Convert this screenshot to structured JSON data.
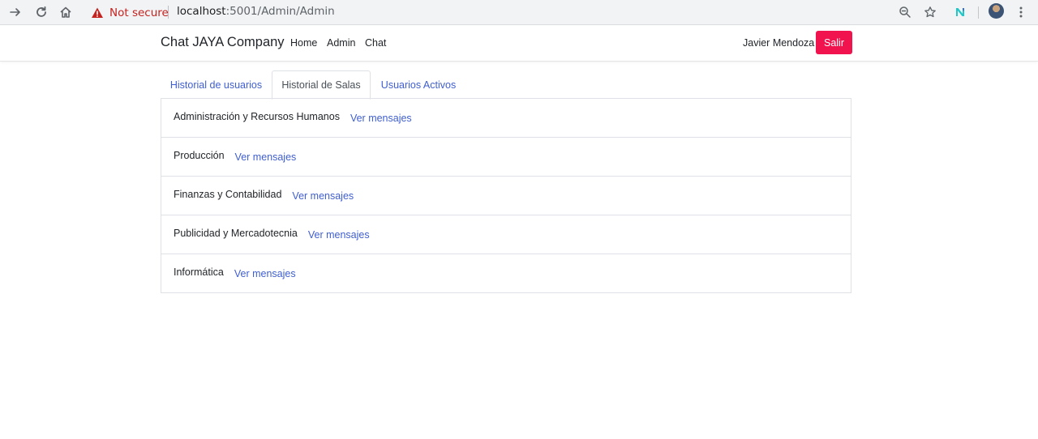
{
  "browser": {
    "security_label": "Not secure",
    "url_host": "localhost",
    "url_rest": ":5001/Admin/Admin",
    "icons": [
      "forward-arrow-icon",
      "reload-icon",
      "home-icon",
      "warning-icon",
      "zoom-icon",
      "star-icon",
      "extension-icon",
      "avatar",
      "menu-icon"
    ]
  },
  "navbar": {
    "brand": "Chat JAYA Company",
    "links": [
      "Home",
      "Admin",
      "Chat"
    ],
    "user_name": "Javier Mendoza",
    "logout_label": "Salir",
    "logout_color": "#f0134d"
  },
  "tabs": {
    "items": [
      "Historial de usuarios",
      "Historial de Salas",
      "Usuarios Activos"
    ],
    "active": "Historial de Salas",
    "link_color": "#3f5ed1"
  },
  "rooms": {
    "items": [
      {
        "name": "Administración y Recursos Humanos",
        "link": "Ver mensajes"
      },
      {
        "name": "Producción",
        "link": "Ver mensajes"
      },
      {
        "name": "Finanzas y Contabilidad",
        "link": "Ver mensajes"
      },
      {
        "name": "Publicidad y Mercadotecnia",
        "link": "Ver mensajes"
      },
      {
        "name": "Informática",
        "link": "Ver mensajes"
      }
    ]
  }
}
